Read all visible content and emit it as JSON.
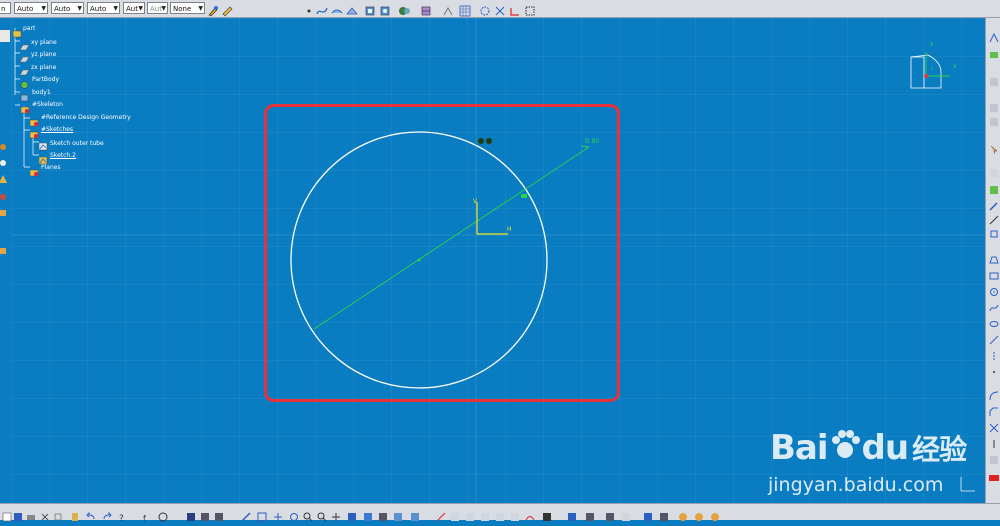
{
  "toolbar": {
    "combos": [
      "Auto",
      "Auto",
      "Auto",
      "Aut",
      "Aut",
      "None"
    ],
    "left_stub": "n"
  },
  "tree": [
    {
      "label": "part",
      "underline": false
    },
    {
      "label": "xy plane",
      "underline": false
    },
    {
      "label": "yz plane",
      "underline": false
    },
    {
      "label": "zx plane",
      "underline": false
    },
    {
      "label": "PartBody",
      "underline": false
    },
    {
      "label": "body1",
      "underline": false
    },
    {
      "label": "#Skeleton",
      "underline": false
    },
    {
      "label": "#Reference Design Geometry",
      "underline": false
    },
    {
      "label": "#Sketches",
      "underline": true
    },
    {
      "label": "Sketch outer tube",
      "underline": false
    },
    {
      "label": "Sketch.2",
      "underline": true
    },
    {
      "label": "Planes",
      "underline": false
    }
  ],
  "sketch": {
    "dimension_label": "D 80",
    "axis_v": "V",
    "axis_h": "H"
  },
  "compass": {
    "axis_y": "y",
    "axis_x": "x",
    "axis_z": "z"
  },
  "watermark": {
    "brand": "Bai",
    "brand2": "du",
    "cn": "经验",
    "url": "jingyan.baidu.com"
  },
  "colors": {
    "background": "#0a7cc2",
    "circle": "#ffffff",
    "dimension": "#2bd34a",
    "axes": "#f2e21a",
    "highlight": "#e8313a"
  }
}
